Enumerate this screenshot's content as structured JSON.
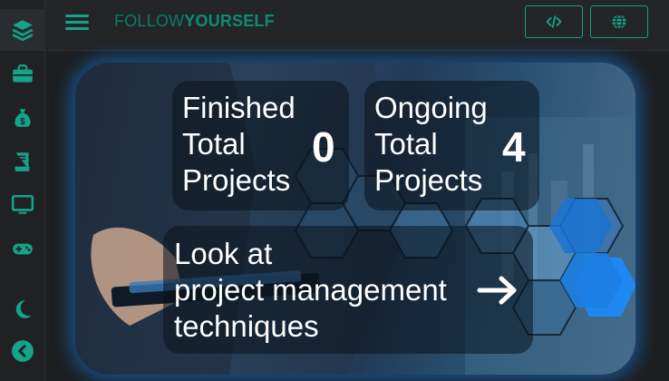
{
  "brand": {
    "light": "FOLLOW",
    "bold": "YOURSELF"
  },
  "sidebar": {
    "items": [
      {
        "icon": "layers-icon"
      },
      {
        "icon": "briefcase-icon"
      },
      {
        "icon": "money-bag-icon"
      },
      {
        "icon": "book-icon"
      },
      {
        "icon": "monitor-icon"
      },
      {
        "icon": "gamepad-icon"
      },
      {
        "icon": "moon-icon"
      },
      {
        "icon": "chevron-left-icon"
      }
    ]
  },
  "topbar": {
    "code_button_icon": "code-icon",
    "language_button_icon": "globe-icon"
  },
  "stats": {
    "finished": {
      "line1": "Finished",
      "line2": "Total",
      "line3": "Projects",
      "value": "0"
    },
    "ongoing": {
      "line1": "Ongoing",
      "line2": "Total",
      "line3": "Projects",
      "value": "4"
    }
  },
  "cta": {
    "line1": "Look at",
    "line2": "project management",
    "line3": "techniques",
    "icon": "arrow-right-icon"
  },
  "colors": {
    "accent": "#14a38b",
    "glow": "#1478dc",
    "hex_blue": "#1e88f0"
  }
}
